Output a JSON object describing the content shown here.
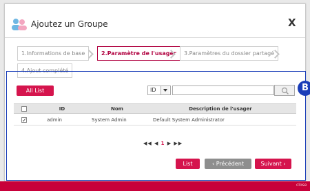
{
  "dialog": {
    "title": "Ajoutez un Groupe",
    "close_label": "X"
  },
  "steps": [
    {
      "label": "1.Informations de base"
    },
    {
      "label": "2.Paramètre de l'usager"
    },
    {
      "label": "3.Paramètres du dossier partagé"
    },
    {
      "label": "4.Ajout complété"
    }
  ],
  "toolbar": {
    "all_list_label": "All List",
    "search_field_value": "ID",
    "search_value": "",
    "search_icon": "magnifier-icon"
  },
  "table": {
    "columns": [
      "ID",
      "Nom",
      "Description de l'usager"
    ],
    "rows": [
      {
        "checked": true,
        "id": "admin",
        "name": "System Admin",
        "description": "Default System Administrator"
      }
    ]
  },
  "pagination": {
    "first": "◀◀",
    "prev": "◀",
    "current": "1",
    "next": "▶",
    "last": "▶▶"
  },
  "buttons": {
    "list_label": "List",
    "prev_label": "‹ Précédent",
    "next_label": "Suivant ›"
  },
  "annotation_badge": "B",
  "footer": {
    "close_label": "close"
  },
  "colors": {
    "accent": "#d5144d",
    "highlight_box": "#1a3db8"
  }
}
